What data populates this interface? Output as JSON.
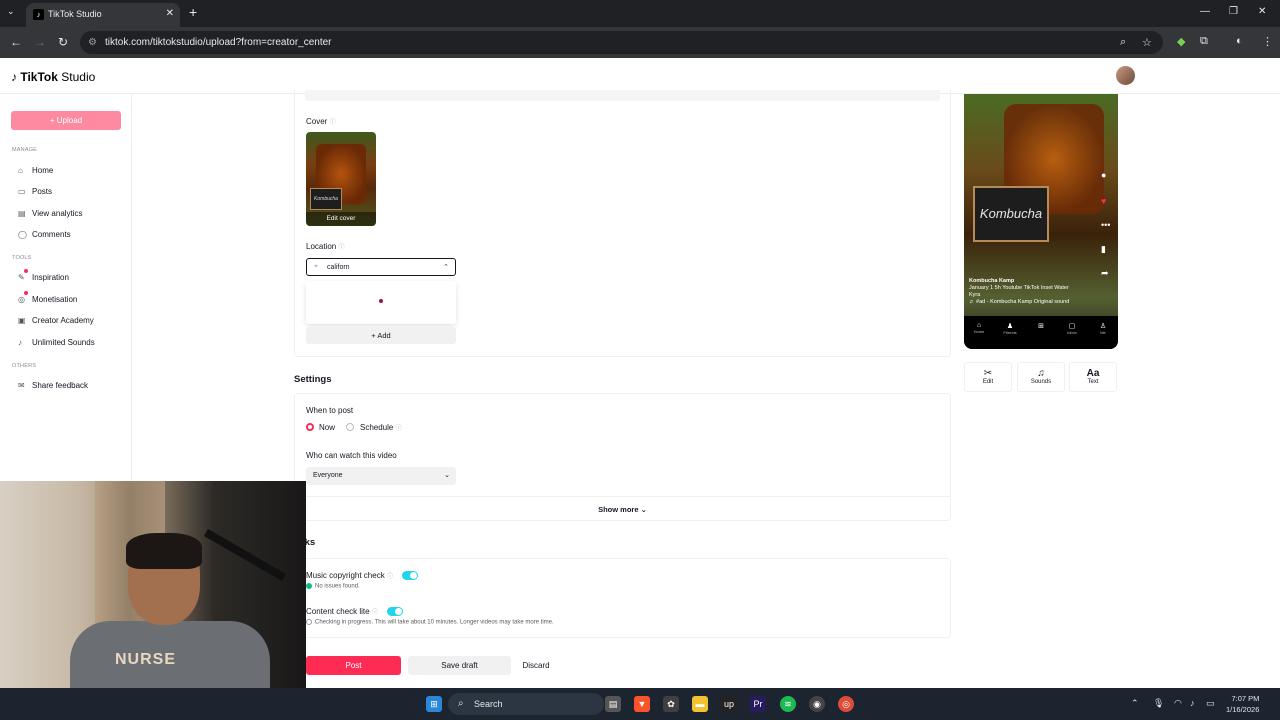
{
  "browser": {
    "tab_title": "TikTok Studio",
    "url": "tiktok.com/tiktokstudio/upload?from=creator_center"
  },
  "app": {
    "logo": "TikTok",
    "logo_suffix": "Studio"
  },
  "sidebar": {
    "upload_label": "+ Upload",
    "manage_label": "MANAGE",
    "tools_label": "TOOLS",
    "others_label": "OTHERS",
    "manage_items": [
      {
        "label": "Home",
        "icon": "home-icon"
      },
      {
        "label": "Posts",
        "icon": "posts-icon"
      },
      {
        "label": "View analytics",
        "icon": "analytics-icon"
      },
      {
        "label": "Comments",
        "icon": "comments-icon"
      }
    ],
    "tools_items": [
      {
        "label": "Inspiration",
        "icon": "bulb-icon"
      },
      {
        "label": "Monetisation",
        "icon": "money-icon"
      },
      {
        "label": "Creator Academy",
        "icon": "academy-icon"
      },
      {
        "label": "Unlimited Sounds",
        "icon": "music-note-icon"
      }
    ],
    "others_items": [
      {
        "label": "Share feedback",
        "icon": "feedback-icon"
      }
    ]
  },
  "details": {
    "cover_label": "Cover",
    "cover_edit": "Edit cover",
    "cover_sign": "Kombucha",
    "location_label": "Location",
    "location_value": "californ",
    "add_label": "+ Add"
  },
  "settings": {
    "title": "Settings",
    "when_label": "When to post",
    "now_label": "Now",
    "schedule_label": "Schedule",
    "who_label": "Who can watch this video",
    "who_value": "Everyone",
    "show_more": "Show more"
  },
  "checks": {
    "title": "ecks",
    "music_label": "Music copyright check",
    "music_status": "No issues found.",
    "content_label": "Content check lite",
    "content_status": "Checking in progress. This will take about 10 minutes. Longer videos may take more time."
  },
  "actions": {
    "post": "Post",
    "save_draft": "Save draft",
    "discard": "Discard"
  },
  "preview": {
    "sign": "Kombucha",
    "account": "Kombucha Kamp",
    "caption": "January 1 5h Youtube TikTok Inset Water Kyra",
    "sound": "♬ #ad - Kombucha Kamp   Original sound",
    "nav": [
      "Home",
      "Friends",
      "",
      "Inbox",
      "Me"
    ],
    "tools": [
      {
        "label": "Edit",
        "icon": "scissors-icon"
      },
      {
        "label": "Sounds",
        "icon": "music-note-icon"
      },
      {
        "label": "Text",
        "icon": "text-icon"
      }
    ]
  },
  "webcam": {
    "shirt_text": "NURSE"
  },
  "taskbar": {
    "search": "Search",
    "time": "7:07 PM",
    "date": "1/16/2026"
  },
  "colors": {
    "brand": "#fe2c55",
    "toggle": "#20d5ec",
    "chrome_dark": "#202124"
  }
}
